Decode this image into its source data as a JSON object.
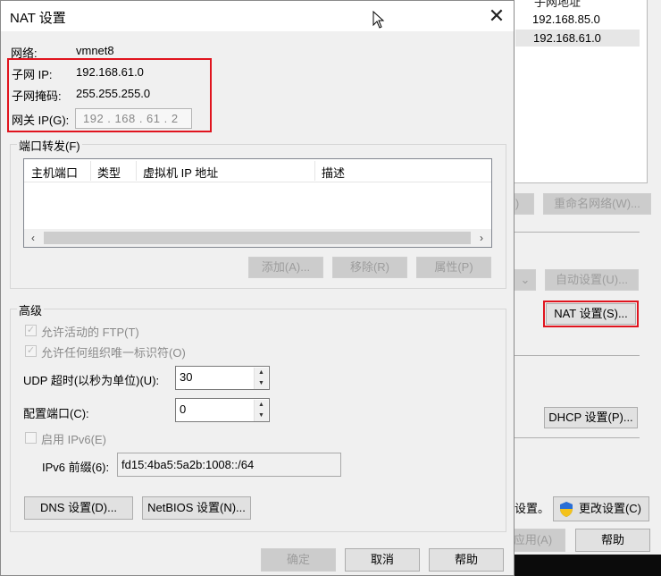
{
  "background_window": {
    "list_header": "子网地址",
    "list_rows": [
      "192.168.85.0",
      "192.168.61.0"
    ],
    "buttons": {
      "partial_left": ")",
      "rename_network": "重命名网络(W)...",
      "auto_settings": "自动设置(U)...",
      "nat_settings": "NAT 设置(S)...",
      "dhcp_settings": "DHCP 设置(P)...",
      "change_settings": "更改设置(C)",
      "apply": "应用(A)",
      "help": "帮助"
    },
    "partial_text": "设置。"
  },
  "dialog": {
    "title": "NAT 设置",
    "network_label": "网络:",
    "network_value": "vmnet8",
    "subnet_ip_label": "子网 IP:",
    "subnet_ip_value": "192.168.61.0",
    "subnet_mask_label": "子网掩码:",
    "subnet_mask_value": "255.255.255.0",
    "gateway_label": "网关 IP(G):",
    "gateway_value": "192 . 168 . 61 . 2",
    "port_forwarding": {
      "title": "端口转发(F)",
      "columns": [
        "主机端口",
        "类型",
        "虚拟机 IP 地址",
        "描述"
      ],
      "add": "添加(A)...",
      "remove": "移除(R)",
      "properties": "属性(P)"
    },
    "advanced": {
      "title": "高级",
      "allow_ftp": "允许活动的 FTP(T)",
      "allow_any_oui": "允许任何组织唯一标识符(O)",
      "udp_timeout_label": "UDP 超时(以秒为单位)(U):",
      "udp_timeout_value": "30",
      "config_port_label": "配置端口(C):",
      "config_port_value": "0",
      "enable_ipv6": "启用 IPv6(E)",
      "ipv6_prefix_label": "IPv6 前缀(6):",
      "ipv6_prefix_value": "fd15:4ba5:5a2b:1008::/64",
      "dns_settings": "DNS 设置(D)...",
      "netbios_settings": "NetBIOS 设置(N)..."
    },
    "footer": {
      "ok": "确定",
      "cancel": "取消",
      "help": "帮助"
    }
  },
  "colors": {
    "highlight_red": "#e0141e",
    "dialog_bg": "#f0f0f0"
  }
}
